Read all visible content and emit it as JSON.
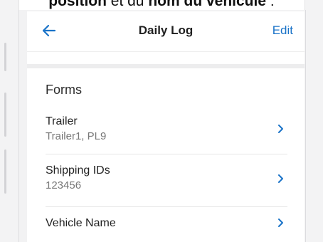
{
  "caption": {
    "part1": "position",
    "part2": " et du ",
    "part3": "nom du véhicule",
    "part4": " :"
  },
  "header": {
    "title": "Daily Log",
    "edit_label": "Edit",
    "back_icon": "arrow-left-icon"
  },
  "forms": {
    "section_title": "Forms",
    "items": [
      {
        "title": "Trailer",
        "subtitle": "Trailer1, PL9"
      },
      {
        "title": "Shipping IDs",
        "subtitle": "123456"
      },
      {
        "title": "Vehicle Name",
        "subtitle": ""
      }
    ]
  },
  "colors": {
    "accent": "#1a73c8",
    "text": "#222222",
    "secondary_text": "#777777"
  }
}
